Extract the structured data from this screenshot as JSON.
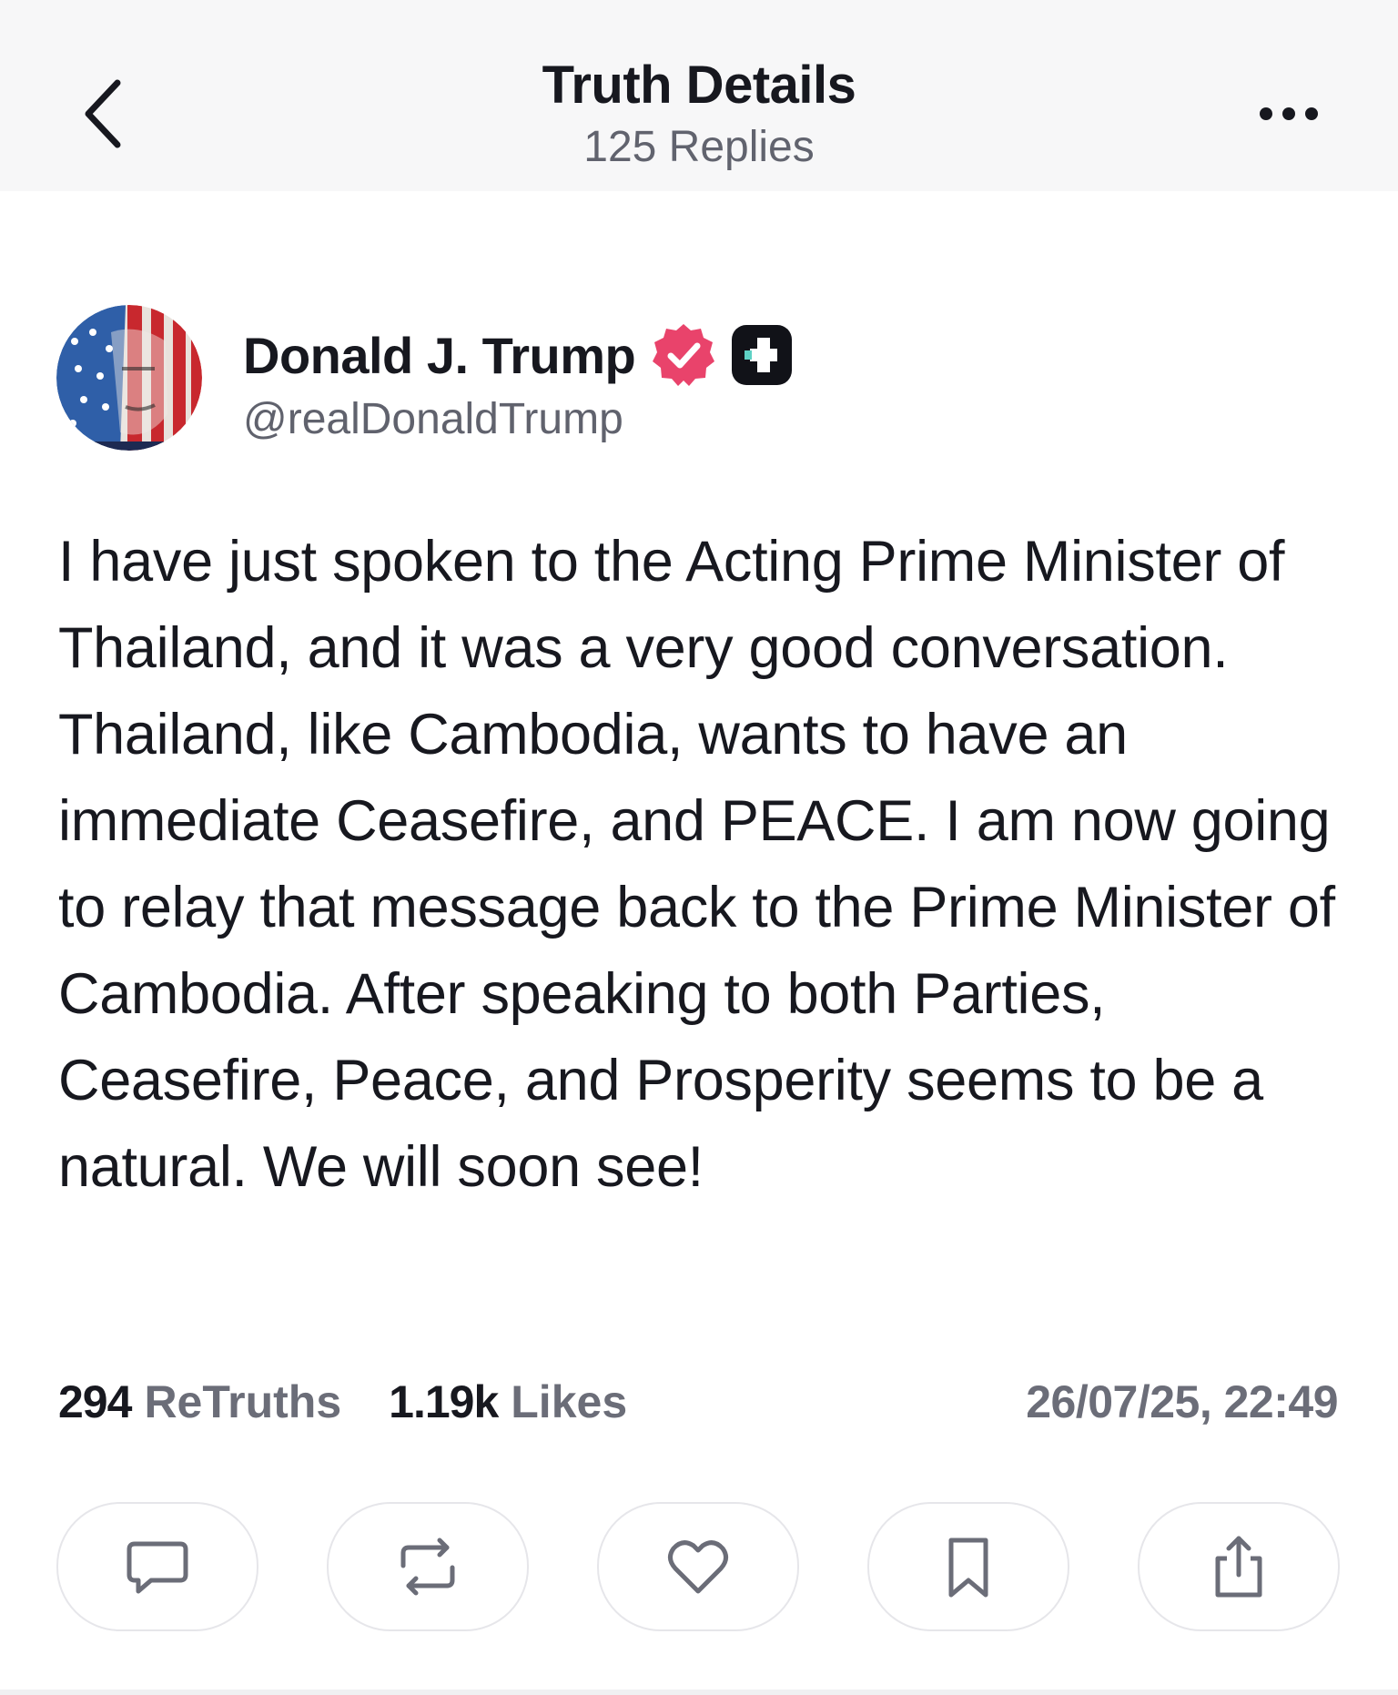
{
  "header": {
    "title": "Truth Details",
    "subtitle": "125 Replies"
  },
  "author": {
    "name": "Donald J. Trump",
    "handle": "@realDonaldTrump"
  },
  "post": {
    "text": "I have just spoken to the Acting Prime Minister of Thailand, and it was a very good conversation. Thailand, like Cambodia, wants to have an immediate Ceasefire, and PEACE. I am now going to relay that message back to the Prime Minister of Cambodia. After speaking to both Parties, Ceasefire, Peace, and Prosperity seems to be a natural. We will soon see!"
  },
  "stats": {
    "retruths_count": "294",
    "retruths_label": "ReTruths",
    "likes_count": "1.19k",
    "likes_label": "Likes",
    "timestamp": "26/07/25, 22:49"
  },
  "actions": [
    {
      "icon": "comment-icon"
    },
    {
      "icon": "retruth-icon"
    },
    {
      "icon": "heart-icon"
    },
    {
      "icon": "bookmark-icon"
    },
    {
      "icon": "share-icon"
    }
  ],
  "colors": {
    "verified_badge": "#e9436b",
    "text_primary": "#17181f",
    "text_secondary": "#61636e",
    "header_bg": "#f7f7f8"
  }
}
